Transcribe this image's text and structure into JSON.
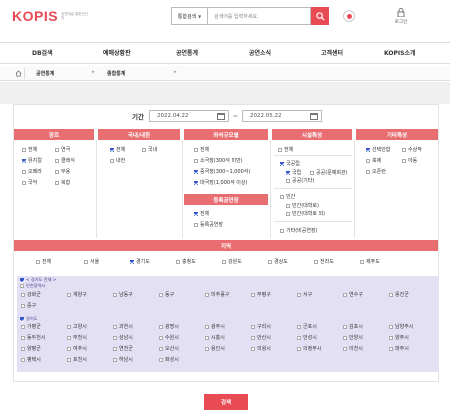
{
  "header": {
    "logo": "KOPIS",
    "logo_sub": "공연예술 통합전산망",
    "search_select": "통합검색",
    "search_placeholder": "검색어를 입력하세요.",
    "login_label": "로그인"
  },
  "nav": [
    "DB검색",
    "예매상황판",
    "공연통계",
    "공연소식",
    "고객센터",
    "KOPIS소개"
  ],
  "breadcrumb": {
    "level1": "공연통계",
    "level2": "종합통계",
    "arrow": "▸"
  },
  "period": {
    "label": "기간",
    "start": "2022.04.22",
    "separator": "~",
    "end": "2022.05.22"
  },
  "columns": {
    "genre": {
      "header": "장르",
      "items": [
        {
          "label": "전체",
          "checked": false
        },
        {
          "label": "연극",
          "checked": false
        },
        {
          "label": "뮤지컬",
          "checked": true
        },
        {
          "label": "클래식",
          "checked": false
        },
        {
          "label": "오페라",
          "checked": false
        },
        {
          "label": "무용",
          "checked": false
        },
        {
          "label": "국악",
          "checked": false
        },
        {
          "label": "복합",
          "checked": false
        }
      ]
    },
    "domestic": {
      "header": "국내/내한",
      "items": [
        {
          "label": "전체",
          "checked": true
        },
        {
          "label": "국내",
          "checked": false
        },
        {
          "label": "내한",
          "checked": false
        }
      ]
    },
    "scale": {
      "header": "좌석규모별",
      "items": [
        {
          "label": "전체",
          "checked": false
        },
        {
          "label": "소극장(300석 미만)",
          "checked": false
        },
        {
          "label": "중극장(300~1,000석)",
          "checked": true
        },
        {
          "label": "대극장(1,000석 이상)",
          "checked": true
        }
      ]
    },
    "registered": {
      "header": "등록공연장",
      "items": [
        {
          "label": "전체",
          "checked": true
        },
        {
          "label": "등록공연장",
          "checked": false
        }
      ]
    },
    "facility": {
      "header": "시설특성",
      "items": [
        {
          "label": "전체",
          "checked": false
        },
        {
          "label": "국공립",
          "checked": true
        },
        {
          "label": "국립",
          "checked": true
        },
        {
          "label": "공공(문예회관)",
          "checked": false
        },
        {
          "label": "공공(기타)",
          "checked": false
        },
        {
          "label": "민간",
          "checked": false
        },
        {
          "label": "민간(대학로)",
          "checked": false
        },
        {
          "label": "민간(대학로 외)",
          "checked": false
        },
        {
          "label": "기타(비공연장)",
          "checked": false
        }
      ]
    },
    "other": {
      "header": "기타특성",
      "items": [
        {
          "label": "선택안함",
          "checked": true
        },
        {
          "label": "수상작",
          "checked": false
        },
        {
          "label": "축제",
          "checked": false
        },
        {
          "label": "아동",
          "checked": false
        },
        {
          "label": "오픈런",
          "checked": false
        }
      ]
    }
  },
  "region": {
    "header": "지역",
    "items": [
      {
        "label": "전체",
        "checked": false
      },
      {
        "label": "서울",
        "checked": false
      },
      {
        "label": "경기도",
        "checked": true
      },
      {
        "label": "충청도",
        "checked": false
      },
      {
        "label": "강원도",
        "checked": false
      },
      {
        "label": "경상도",
        "checked": false
      },
      {
        "label": "전라도",
        "checked": false
      },
      {
        "label": "제주도",
        "checked": false
      }
    ]
  },
  "subregion": {
    "all_label": "< 경기도 전체 >",
    "group1_label": "인천광역시",
    "group1": [
      "강화군",
      "계양구",
      "남동구",
      "동구",
      "미추홀구",
      "부평구",
      "서구",
      "연수구",
      "옹진군",
      "중구"
    ],
    "group2_label": "경기도",
    "group2": [
      "가평군",
      "고양시",
      "과천시",
      "광명시",
      "광주시",
      "구리시",
      "군포시",
      "김포시",
      "남양주시",
      "동두천시",
      "부천시",
      "성남시",
      "수원시",
      "시흥시",
      "안산시",
      "안성시",
      "안양시",
      "양주시",
      "양평군",
      "여주시",
      "연천군",
      "오산시",
      "용인시",
      "의왕시",
      "의정부시",
      "이천시",
      "파주시",
      "평택시",
      "포천시",
      "하남시",
      "화성시"
    ]
  },
  "search_button": "검색",
  "colors": {
    "accent": "#e94b55",
    "header_bar": "#e96e72",
    "sub_bg": "#e4e0f4"
  }
}
